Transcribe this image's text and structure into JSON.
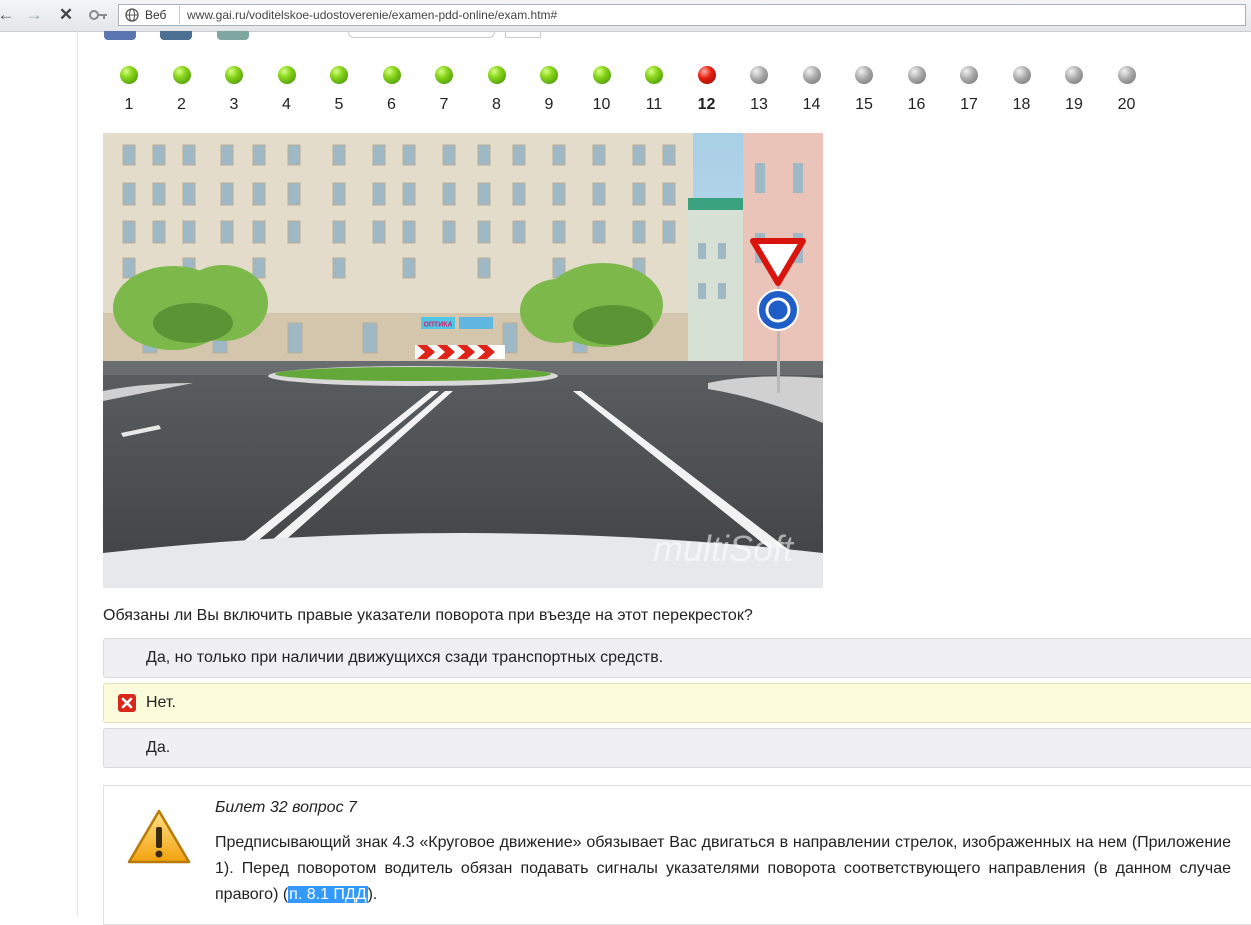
{
  "browser": {
    "mode_chip": "Веб",
    "url": "www.gai.ru/voditelskoe-udostoverenie/examen-pdd-online/exam.htm#"
  },
  "progress": {
    "current": "12",
    "questions": [
      {
        "num": "1",
        "status": "correct"
      },
      {
        "num": "2",
        "status": "correct"
      },
      {
        "num": "3",
        "status": "correct"
      },
      {
        "num": "4",
        "status": "correct"
      },
      {
        "num": "5",
        "status": "correct"
      },
      {
        "num": "6",
        "status": "correct"
      },
      {
        "num": "7",
        "status": "correct"
      },
      {
        "num": "8",
        "status": "correct"
      },
      {
        "num": "9",
        "status": "correct"
      },
      {
        "num": "10",
        "status": "correct"
      },
      {
        "num": "11",
        "status": "correct"
      },
      {
        "num": "12",
        "status": "wrong"
      },
      {
        "num": "13",
        "status": "pending"
      },
      {
        "num": "14",
        "status": "pending"
      },
      {
        "num": "15",
        "status": "pending"
      },
      {
        "num": "16",
        "status": "pending"
      },
      {
        "num": "17",
        "status": "pending"
      },
      {
        "num": "18",
        "status": "pending"
      },
      {
        "num": "19",
        "status": "pending"
      },
      {
        "num": "20",
        "status": "pending"
      }
    ]
  },
  "scene": {
    "shop_sign": "ОПТИКА",
    "watermark": "multiSoft"
  },
  "question": {
    "text": "Обязаны ли Вы включить правые указатели поворота при въезде на этот перекресток?"
  },
  "answers": [
    {
      "text": "Да, но только при наличии движущихся сзади транспортных средств.",
      "state": "normal"
    },
    {
      "text": "Нет.",
      "state": "selected-wrong"
    },
    {
      "text": "Да.",
      "state": "normal"
    }
  ],
  "explanation": {
    "ticket": "Билет 32 вопрос 7",
    "text_before": "Предписывающий знак 4.3 «Круговое движение» обязывает Вас двигаться в направлении стрелок, изображенных на нем (Приложение 1). Перед поворотом водитель обязан подавать сигналы указателями поворота соответствующего направления (в данном случае правого) (",
    "link": "п. 8.1 ПДД",
    "text_after": ")."
  },
  "colors": {
    "correct": "#6cc70f",
    "wrong": "#e02010",
    "pending": "#9a9a9a",
    "selected_bg": "#fcfcdc",
    "link_highlight": "#3399ff"
  },
  "icons": [
    "back-icon",
    "forward-icon",
    "stop-icon",
    "key-icon",
    "globe-icon",
    "close-x-icon",
    "warning-icon"
  ]
}
